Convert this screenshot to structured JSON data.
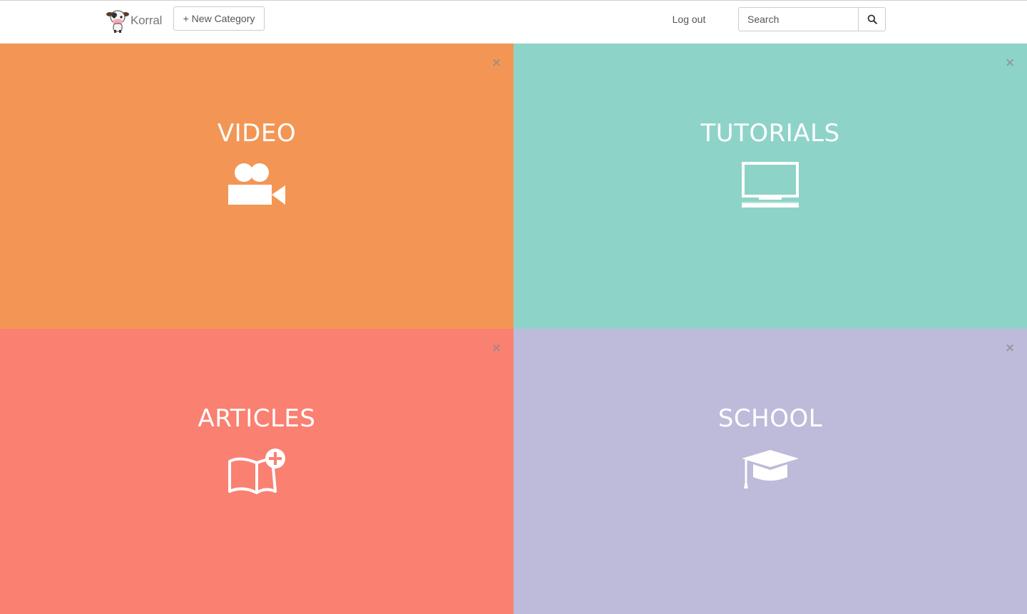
{
  "navbar": {
    "brand_name": "Korral",
    "new_category_label": "+ New Category",
    "logout_label": "Log out",
    "search_placeholder": "Search"
  },
  "tiles": [
    {
      "title": "VIDEO",
      "icon": "video-camera-icon",
      "color": "#F39655",
      "close": "×"
    },
    {
      "title": "TUTORIALS",
      "icon": "monitor-icon",
      "color": "#8ED3C7",
      "close": "×"
    },
    {
      "title": "ARTICLES",
      "icon": "book-add-icon",
      "color": "#FA8072",
      "close": "×"
    },
    {
      "title": "SCHOOL",
      "icon": "graduation-cap-icon",
      "color": "#BEBADA",
      "close": "×"
    }
  ]
}
